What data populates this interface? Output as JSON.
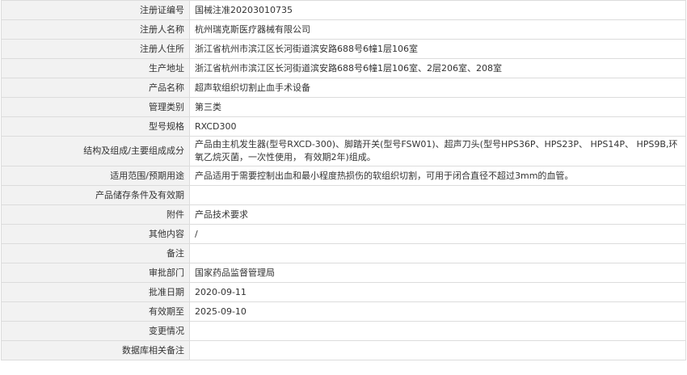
{
  "rows": [
    {
      "label": "注册证编号",
      "value": "国械注准20203010735"
    },
    {
      "label": "注册人名称",
      "value": "杭州瑞克斯医疗器械有限公司"
    },
    {
      "label": "注册人住所",
      "value": "浙江省杭州市滨江区长河街道滨安路688号6幢1层106室"
    },
    {
      "label": "生产地址",
      "value": "浙江省杭州市滨江区长河街道滨安路688号6幢1层106室、2层206室、208室"
    },
    {
      "label": "产品名称",
      "value": "超声软组织切割止血手术设备"
    },
    {
      "label": "管理类别",
      "value": "第三类"
    },
    {
      "label": "型号规格",
      "value": "RXCD300"
    },
    {
      "label": "结构及组成/主要组成成分",
      "value": "产品由主机发生器(型号RXCD-300)、脚踏开关(型号FSW01)、超声刀头(型号HPS36P、HPS23P、 HPS14P、 HPS9B,环氧乙烷灭菌，一次性使用， 有效期2年)组成。"
    },
    {
      "label": "适用范围/预期用途",
      "value": "产品适用于需要控制出血和最小程度热损伤的软组织切割，可用于闭合直径不超过3mm的血管。"
    },
    {
      "label": "产品储存条件及有效期",
      "value": ""
    },
    {
      "label": "附件",
      "value": "产品技术要求"
    },
    {
      "label": "其他内容",
      "value": "/"
    },
    {
      "label": "备注",
      "value": ""
    },
    {
      "label": "审批部门",
      "value": "国家药品监督管理局"
    },
    {
      "label": "批准日期",
      "value": "2020-09-11"
    },
    {
      "label": "有效期至",
      "value": "2025-09-10"
    },
    {
      "label": "变更情况",
      "value": ""
    },
    {
      "label": "数据库相关备注",
      "value": ""
    }
  ]
}
